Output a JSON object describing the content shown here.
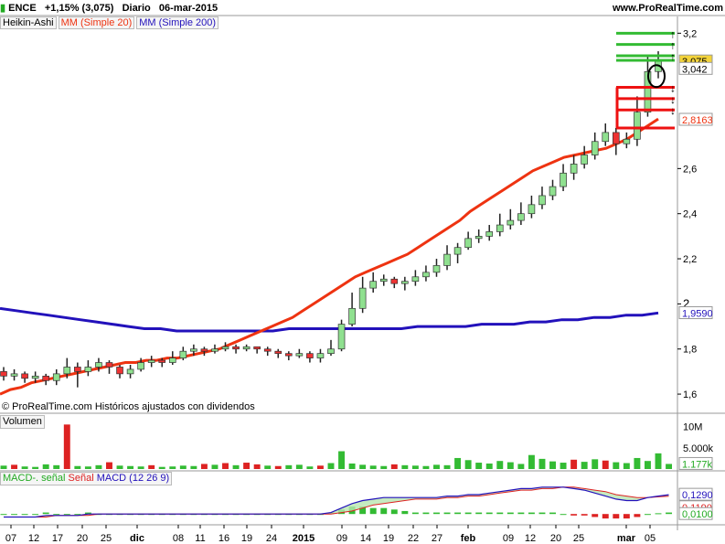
{
  "header": {
    "ticker": "ENCE",
    "change": "+1,15% (3,075)",
    "period": "Diario",
    "date": "06-mar-2015",
    "site": "www.ProRealTime.com"
  },
  "legend": {
    "chart_type": "Heikin-Ashi",
    "ma20": "MM (Simple 20)",
    "ma200": "MM (Simple 200)"
  },
  "credit": "© ProRealTime.com Históricos ajustados con dividendos",
  "volume_panel": {
    "title": "Volumen",
    "ticks": [
      "10M",
      "5.000k"
    ],
    "current": "1.177k"
  },
  "macd_panel": {
    "labels": [
      "MACD-. señal",
      "Señal",
      "MACD (12 26 9)"
    ],
    "values": [
      "0,1290",
      "0,1190",
      "0,0100"
    ]
  },
  "colors": {
    "up": "#33bb33",
    "down": "#dd2222",
    "ma20": "#ee3311",
    "ma200": "#2211bb",
    "resistance": "#33bb33",
    "support": "#ee1111",
    "price_tag": "#f3d33a"
  },
  "chart_data": [
    {
      "type": "candlestick",
      "title": "ENCE",
      "ylim": [
        1.58,
        3.25
      ],
      "y_ticks": [
        "3,2",
        "2,6",
        "2,4",
        "2,2",
        "2",
        "1,8",
        "1,6"
      ],
      "x_ticks": [
        "07",
        "12",
        "17",
        "20",
        "25",
        "dic",
        "08",
        "11",
        "16",
        "19",
        "24",
        "2015",
        "09",
        "14",
        "19",
        "22",
        "27",
        "feb",
        "09",
        "12",
        "20",
        "25",
        "mar",
        "05"
      ],
      "price_labels": [
        "3,075",
        "3,042",
        "2,8163",
        "1,9590"
      ],
      "last_close": 3.075,
      "ma20_last": 2.8163,
      "ma200_last": 1.959,
      "resistance_levels": [
        3.2,
        3.15,
        3.1,
        3.08
      ],
      "support_levels": [
        2.96,
        2.91,
        2.86,
        2.78
      ],
      "ma20": [
        1.6,
        1.62,
        1.63,
        1.65,
        1.66,
        1.67,
        1.68,
        1.69,
        1.7,
        1.71,
        1.72,
        1.73,
        1.74,
        1.74,
        1.75,
        1.75,
        1.76,
        1.76,
        1.77,
        1.78,
        1.79,
        1.8,
        1.82,
        1.84,
        1.86,
        1.88,
        1.9,
        1.92,
        1.94,
        1.97,
        2.0,
        2.03,
        2.06,
        2.09,
        2.12,
        2.14,
        2.16,
        2.18,
        2.2,
        2.22,
        2.25,
        2.28,
        2.31,
        2.34,
        2.37,
        2.41,
        2.44,
        2.47,
        2.5,
        2.53,
        2.56,
        2.59,
        2.61,
        2.63,
        2.65,
        2.66,
        2.67,
        2.68,
        2.69,
        2.71,
        2.73,
        2.76,
        2.79,
        2.82
      ],
      "ma200": [
        1.98,
        1.97,
        1.96,
        1.95,
        1.94,
        1.93,
        1.92,
        1.91,
        1.9,
        1.89,
        1.89,
        1.88,
        1.88,
        1.88,
        1.88,
        1.88,
        1.88,
        1.88,
        1.89,
        1.89,
        1.89,
        1.89,
        1.89,
        1.89,
        1.89,
        1.89,
        1.9,
        1.9,
        1.9,
        1.9,
        1.91,
        1.91,
        1.91,
        1.92,
        1.92,
        1.93,
        1.93,
        1.94,
        1.94,
        1.95,
        1.95,
        1.96
      ],
      "candles": [
        [
          1.7,
          1.68,
          1.72,
          1.66
        ],
        [
          1.68,
          1.69,
          1.71,
          1.66
        ],
        [
          1.69,
          1.67,
          1.7,
          1.65
        ],
        [
          1.67,
          1.68,
          1.7,
          1.65
        ],
        [
          1.68,
          1.66,
          1.69,
          1.64
        ],
        [
          1.66,
          1.69,
          1.71,
          1.64
        ],
        [
          1.69,
          1.72,
          1.76,
          1.67
        ],
        [
          1.72,
          1.7,
          1.74,
          1.63
        ],
        [
          1.7,
          1.72,
          1.75,
          1.68
        ],
        [
          1.72,
          1.74,
          1.76,
          1.7
        ],
        [
          1.74,
          1.72,
          1.75,
          1.69
        ],
        [
          1.72,
          1.69,
          1.73,
          1.67
        ],
        [
          1.69,
          1.71,
          1.73,
          1.67
        ],
        [
          1.71,
          1.74,
          1.76,
          1.7
        ],
        [
          1.74,
          1.75,
          1.77,
          1.72
        ],
        [
          1.75,
          1.74,
          1.76,
          1.72
        ],
        [
          1.74,
          1.76,
          1.79,
          1.73
        ],
        [
          1.76,
          1.79,
          1.81,
          1.75
        ],
        [
          1.79,
          1.8,
          1.82,
          1.77
        ],
        [
          1.8,
          1.79,
          1.81,
          1.77
        ],
        [
          1.79,
          1.8,
          1.82,
          1.78
        ],
        [
          1.8,
          1.81,
          1.83,
          1.79
        ],
        [
          1.81,
          1.8,
          1.82,
          1.78
        ],
        [
          1.8,
          1.81,
          1.82,
          1.79
        ],
        [
          1.81,
          1.8,
          1.81,
          1.78
        ],
        [
          1.8,
          1.79,
          1.81,
          1.77
        ],
        [
          1.79,
          1.78,
          1.8,
          1.76
        ],
        [
          1.78,
          1.77,
          1.79,
          1.75
        ],
        [
          1.77,
          1.78,
          1.8,
          1.76
        ],
        [
          1.78,
          1.76,
          1.79,
          1.74
        ],
        [
          1.76,
          1.78,
          1.8,
          1.74
        ],
        [
          1.78,
          1.8,
          1.84,
          1.77
        ],
        [
          1.8,
          1.91,
          1.93,
          1.79
        ],
        [
          1.91,
          1.98,
          2.05,
          1.9
        ],
        [
          1.98,
          2.07,
          2.12,
          1.96
        ],
        [
          2.07,
          2.1,
          2.14,
          2.05
        ],
        [
          2.1,
          2.11,
          2.13,
          2.08
        ],
        [
          2.11,
          2.09,
          2.12,
          2.07
        ],
        [
          2.09,
          2.1,
          2.12,
          2.06
        ],
        [
          2.1,
          2.12,
          2.15,
          2.08
        ],
        [
          2.12,
          2.14,
          2.17,
          2.1
        ],
        [
          2.14,
          2.17,
          2.2,
          2.12
        ],
        [
          2.17,
          2.22,
          2.26,
          2.15
        ],
        [
          2.22,
          2.25,
          2.27,
          2.18
        ],
        [
          2.25,
          2.29,
          2.32,
          2.24
        ],
        [
          2.29,
          2.3,
          2.33,
          2.27
        ],
        [
          2.3,
          2.32,
          2.35,
          2.28
        ],
        [
          2.32,
          2.35,
          2.4,
          2.3
        ],
        [
          2.35,
          2.37,
          2.42,
          2.33
        ],
        [
          2.37,
          2.4,
          2.45,
          2.35
        ],
        [
          2.4,
          2.44,
          2.48,
          2.38
        ],
        [
          2.44,
          2.48,
          2.52,
          2.42
        ],
        [
          2.48,
          2.52,
          2.55,
          2.46
        ],
        [
          2.52,
          2.58,
          2.62,
          2.5
        ],
        [
          2.58,
          2.62,
          2.66,
          2.55
        ],
        [
          2.62,
          2.66,
          2.7,
          2.6
        ],
        [
          2.66,
          2.72,
          2.76,
          2.64
        ],
        [
          2.72,
          2.76,
          2.8,
          2.7
        ],
        [
          2.76,
          2.71,
          2.78,
          2.66
        ],
        [
          2.71,
          2.73,
          2.76,
          2.69
        ],
        [
          2.73,
          2.85,
          2.92,
          2.7
        ],
        [
          2.85,
          3.03,
          3.1,
          2.83
        ],
        [
          3.03,
          3.075,
          3.12,
          3.0
        ]
      ]
    },
    {
      "type": "bar",
      "title": "Volumen",
      "ylim": [
        0,
        11
      ],
      "unit": "M",
      "colors": [
        "g",
        "r",
        "g",
        "g",
        "g",
        "g",
        "r",
        "g",
        "g",
        "g",
        "r",
        "g",
        "g",
        "g",
        "r",
        "g",
        "g",
        "g",
        "g",
        "r",
        "g",
        "r",
        "g",
        "r",
        "r",
        "g",
        "r",
        "g",
        "g",
        "g",
        "r",
        "g",
        "g",
        "g",
        "g",
        "g",
        "g",
        "r",
        "g",
        "g",
        "g",
        "g",
        "g",
        "g",
        "g",
        "g",
        "g",
        "g",
        "g",
        "g",
        "g",
        "g",
        "g",
        "g",
        "r",
        "g",
        "g",
        "r",
        "g",
        "g",
        "g",
        "g",
        "g",
        "g"
      ],
      "values": [
        0.8,
        1.0,
        0.6,
        0.5,
        1.1,
        0.9,
        10.5,
        0.7,
        0.6,
        0.9,
        1.6,
        0.8,
        0.7,
        0.6,
        0.9,
        0.5,
        0.6,
        0.8,
        0.7,
        1.2,
        1.0,
        1.4,
        0.9,
        1.5,
        1.1,
        0.8,
        0.7,
        0.9,
        1.0,
        0.6,
        0.8,
        1.4,
        4.2,
        1.3,
        1.0,
        0.8,
        0.7,
        1.1,
        0.9,
        0.8,
        0.7,
        1.0,
        0.9,
        2.6,
        2.1,
        1.5,
        1.3,
        1.9,
        1.6,
        1.2,
        3.3,
        2.4,
        1.8,
        1.5,
        2.2,
        1.7,
        2.3,
        2.0,
        1.6,
        1.4,
        2.6,
        1.9,
        3.7,
        1.2
      ]
    },
    {
      "type": "line",
      "title": "MACD (12 26 9)",
      "ylim": [
        -0.06,
        0.24
      ],
      "series": [
        {
          "name": "MACD (12 26 9)",
          "values": [
            -0.02,
            -0.02,
            -0.02,
            -0.02,
            -0.01,
            -0.01,
            -0.01,
            -0.01,
            0.0,
            0.0,
            0.0,
            0.0,
            0.0,
            0.0,
            0.0,
            0.0,
            0.0,
            0.0,
            0.0,
            0.0,
            0.0,
            0.0,
            0.0,
            0.0,
            0.0,
            0.0,
            0.0,
            0.0,
            0.0,
            0.0,
            0.0,
            0.01,
            0.04,
            0.07,
            0.09,
            0.1,
            0.11,
            0.11,
            0.11,
            0.11,
            0.11,
            0.11,
            0.12,
            0.12,
            0.13,
            0.13,
            0.14,
            0.15,
            0.16,
            0.17,
            0.17,
            0.18,
            0.18,
            0.18,
            0.17,
            0.16,
            0.14,
            0.12,
            0.1,
            0.09,
            0.09,
            0.11,
            0.12,
            0.129
          ]
        },
        {
          "name": "Señal",
          "values": [
            -0.02,
            -0.02,
            -0.02,
            -0.02,
            -0.02,
            -0.01,
            -0.01,
            -0.01,
            -0.01,
            0.0,
            0.0,
            0.0,
            0.0,
            0.0,
            0.0,
            0.0,
            0.0,
            0.0,
            0.0,
            0.0,
            0.0,
            0.0,
            0.0,
            0.0,
            0.0,
            0.0,
            0.0,
            0.0,
            0.0,
            0.0,
            0.0,
            0.0,
            0.01,
            0.02,
            0.04,
            0.06,
            0.07,
            0.08,
            0.09,
            0.1,
            0.1,
            0.1,
            0.11,
            0.11,
            0.12,
            0.12,
            0.13,
            0.14,
            0.15,
            0.16,
            0.16,
            0.17,
            0.17,
            0.18,
            0.18,
            0.17,
            0.16,
            0.15,
            0.13,
            0.12,
            0.11,
            0.11,
            0.115,
            0.119
          ]
        }
      ]
    }
  ]
}
